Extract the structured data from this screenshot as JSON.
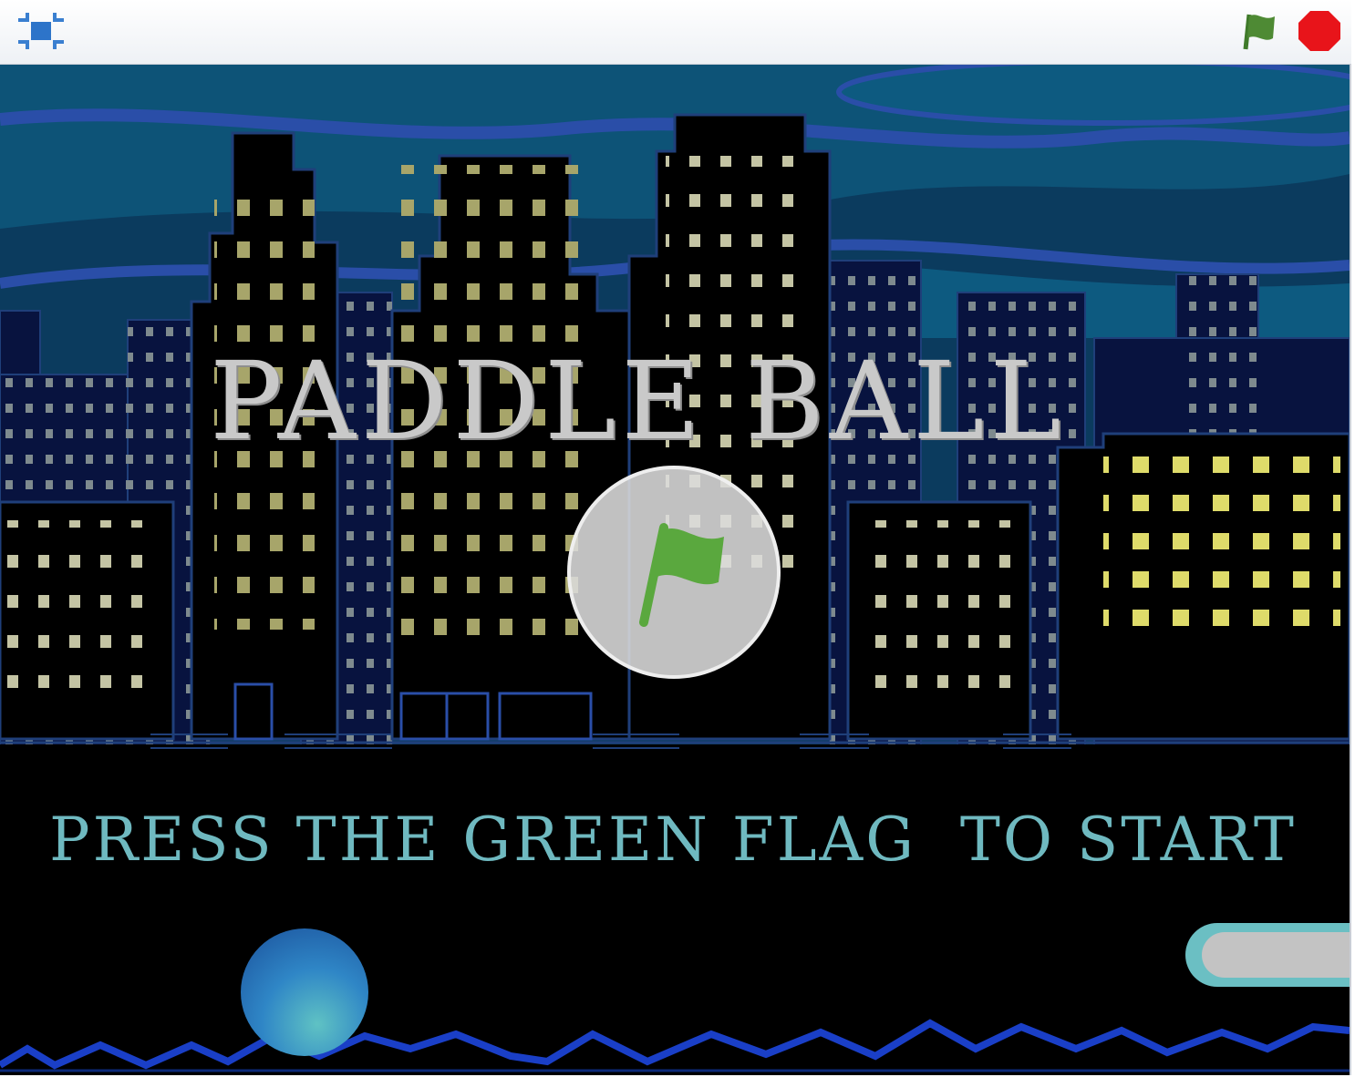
{
  "window": {
    "fullscreen_icon": "fullscreen-icon",
    "green_flag_icon": "green-flag-icon",
    "stop_icon": "stop-sign-icon"
  },
  "stage": {
    "title": "PADDLE BALL",
    "instruction": "PRESS THE GREEN FLAG  TO START",
    "start_overlay_icon": "green-flag-icon"
  },
  "colors": {
    "sky": "#0a4a6b",
    "title": "#c9c9c9",
    "instruction": "#6fb9c0",
    "flag_green": "#5aa83e",
    "stop_red": "#e8141a",
    "ball": "#2f86c6",
    "zigzag": "#1a3fc7"
  }
}
